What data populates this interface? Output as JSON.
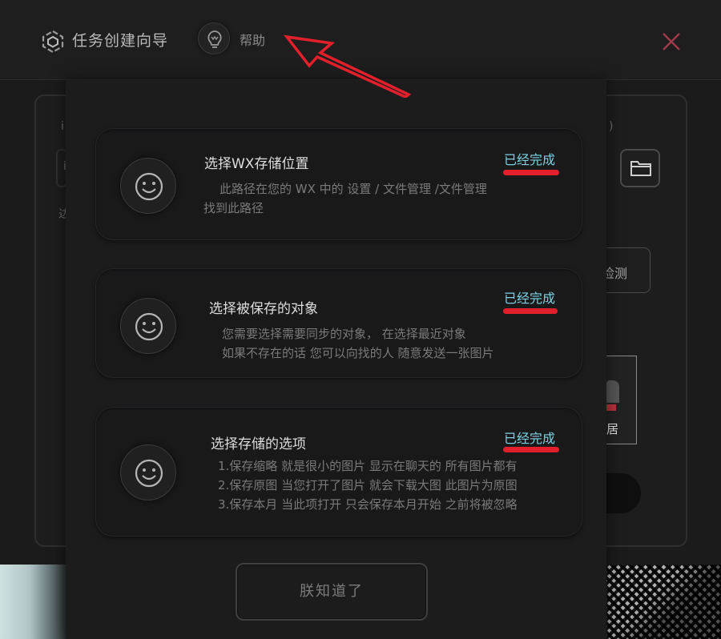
{
  "header": {
    "title": "任务创建向导",
    "help_label": "帮助",
    "logo_icon": "cube-logo-icon",
    "help_icon": "lightbulb-icon",
    "close_icon": "close-icon",
    "close_color": "#a03a4a"
  },
  "background": {
    "fragment_1": "i",
    "fragment_2": "i",
    "fragment_3": "达",
    "fragment_4": ")",
    "detect_button_label": "检测",
    "thumbnail_text": "居",
    "folder_icon": "folder-icon"
  },
  "wizard": {
    "steps": [
      {
        "title": "选择WX存储位置",
        "status": "已经完成",
        "desc_lines": [
          "此路径在您的 WX 中的  设置  /  文件管理  /文件管理",
          "找到此路径"
        ],
        "icon": "smiley-icon"
      },
      {
        "title": "选择被保存的对象",
        "status": "已经完成",
        "desc_lines": [
          "您需要选择需要同步的对象，  在选择最近对象",
          "如果不存在的话 您可以向找的人 随意发送一张图片"
        ],
        "icon": "smiley-icon"
      },
      {
        "title": "选择存储的选项",
        "status": "已经完成",
        "desc_lines": [
          "1.保存缩略  就是很小的图片 显示在聊天的 所有图片都有",
          "2.保存原图  当您打开了图片 就会下载大图 此图片为原图",
          "3.保存本月  当此项打开 只会保存本月开始 之前将被忽略"
        ],
        "icon": "smiley-icon"
      }
    ],
    "ok_button_label": "朕知道了",
    "status_color": "#7dd1e3",
    "annotation_color": "#e2202c"
  }
}
